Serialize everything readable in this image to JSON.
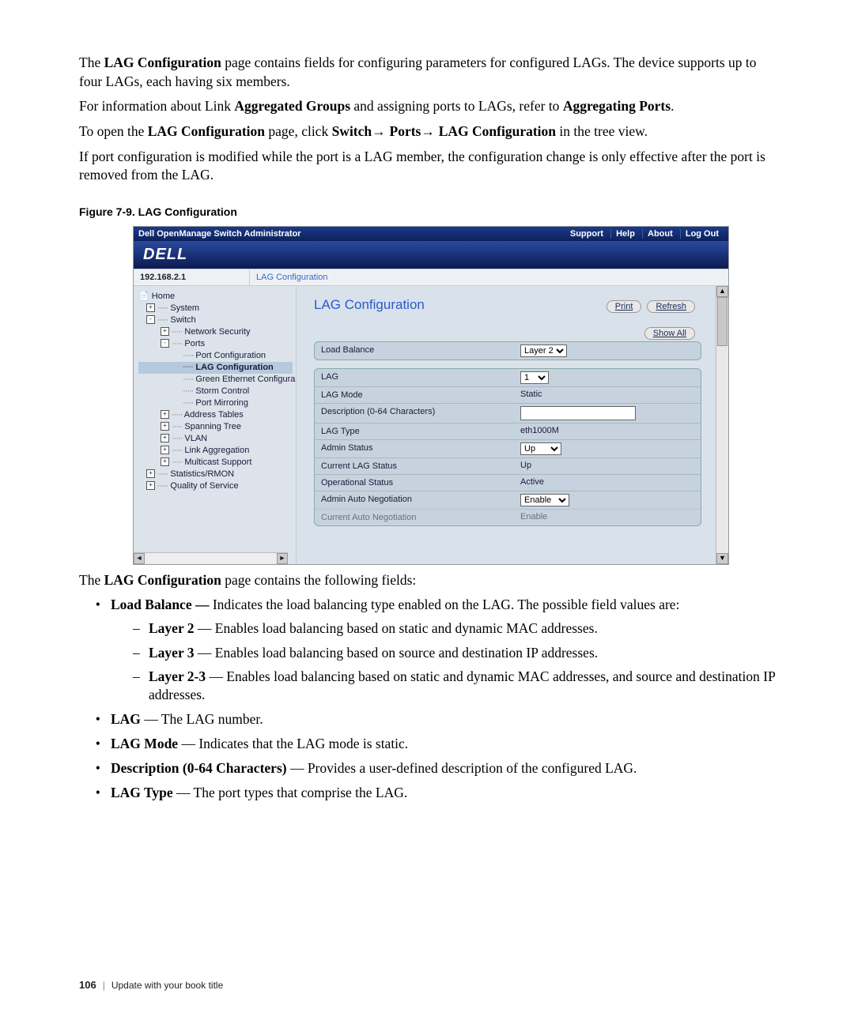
{
  "para1a": "The ",
  "para1b": "LAG Configuration",
  "para1c": " page contains fields for configuring parameters for configured LAGs. The device supports up to four LAGs, each having six members.",
  "para2a": "For information about Link ",
  "para2b": "Aggregated Groups",
  "para2c": " and assigning ports to LAGs, refer to ",
  "para2d": "Aggregating Ports",
  "para2e": ".",
  "para3a": "To open the ",
  "para3b": "LAG Configuration",
  "para3c": " page, click ",
  "para3d": "Switch",
  "para3e": "→ ",
  "para3f": "Ports",
  "para3g": "→ ",
  "para3h": "LAG Configuration",
  "para3i": " in the tree view.",
  "para4": "If port configuration is modified while the port is a LAG member, the configuration change is only effective after the port is removed from the LAG.",
  "fig_caption": "Figure 7-9.    LAG Configuration",
  "app": {
    "title": "Dell OpenManage Switch Administrator",
    "topnav": [
      "Support",
      "Help",
      "About",
      "Log Out"
    ],
    "logo": "DELL",
    "ip": "192.168.2.1",
    "breadcrumb": "LAG Configuration",
    "page_title": "LAG Configuration",
    "btn_print": "Print",
    "btn_refresh": "Refresh",
    "btn_showall": "Show All",
    "tree": {
      "home": "Home",
      "system": "System",
      "switch": "Switch",
      "network_security": "Network Security",
      "ports": "Ports",
      "port_configuration": "Port Configuration",
      "lag_configuration": "LAG Configuration",
      "green_ethernet": "Green Ethernet Configura",
      "storm_control": "Storm Control",
      "port_mirroring": "Port Mirroring",
      "address_tables": "Address Tables",
      "spanning_tree": "Spanning Tree",
      "vlan": "VLAN",
      "link_aggregation": "Link Aggregation",
      "multicast_support": "Multicast Support",
      "stats_rmon": "Statistics/RMON",
      "qos": "Quality of Service"
    },
    "fields": {
      "load_balance_label": "Load Balance",
      "load_balance_value": "Layer 2",
      "lag_label": "LAG",
      "lag_value": "1",
      "lag_mode_label": "LAG Mode",
      "lag_mode_value": "Static",
      "desc_label": "Description (0-64 Characters)",
      "desc_value": "",
      "lag_type_label": "LAG Type",
      "lag_type_value": "eth1000M",
      "admin_status_label": "Admin Status",
      "admin_status_value": "Up",
      "current_status_label": "Current LAG Status",
      "current_status_value": "Up",
      "op_status_label": "Operational Status",
      "op_status_value": "Active",
      "auto_neg_label": "Admin Auto Negotiation",
      "auto_neg_value": "Enable",
      "cur_auto_neg_label": "Current Auto Negotiation",
      "cur_auto_neg_value": "Enable"
    }
  },
  "after_fig_a": "The ",
  "after_fig_b": "LAG Configuration",
  "after_fig_c": " page contains the following fields:",
  "bullets": {
    "lb_b": "Load Balance — ",
    "lb_t": "Indicates the load balancing type enabled on the LAG. The possible field values are:",
    "l2_b": "Layer 2",
    "l2_t": " — Enables load balancing based on static and dynamic MAC addresses.",
    "l3_b": "Layer 3",
    "l3_t": " — Enables load balancing based on source and destination IP addresses.",
    "l23_b": "Layer 2-3",
    "l23_t": " — Enables load balancing based on static and dynamic MAC addresses, and source and destination IP addresses.",
    "lag_b": "LAG",
    "lag_t": " — The LAG number.",
    "mode_b": "LAG Mode",
    "mode_t": " — Indicates that the LAG mode is static.",
    "desc_b": "Description (0-64 Characters)",
    "desc_t": " — Provides a user-defined description of the configured LAG.",
    "type_b": "LAG Type",
    "type_t": " — The port types that comprise the LAG."
  },
  "footer": {
    "page": "106",
    "title": "Update with your book title"
  }
}
